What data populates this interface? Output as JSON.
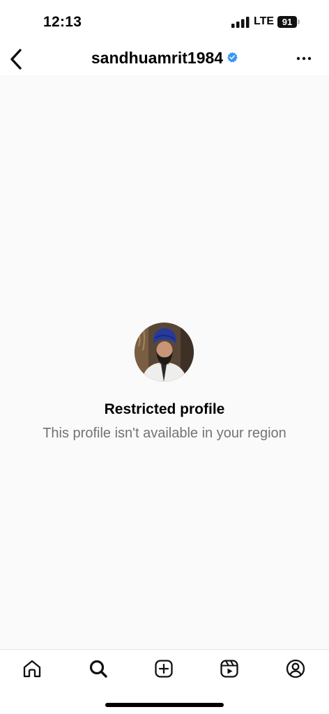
{
  "status_bar": {
    "time": "12:13",
    "network": "LTE",
    "battery_level": "91"
  },
  "header": {
    "username": "sandhuamrit1984",
    "verified": true,
    "accent_color": "#3897f0"
  },
  "restricted": {
    "title": "Restricted profile",
    "message": "This profile isn't available in your region"
  },
  "tab_bar": {
    "tabs": [
      {
        "icon": "home-icon"
      },
      {
        "icon": "search-icon",
        "active": true
      },
      {
        "icon": "create-post-icon"
      },
      {
        "icon": "reels-icon"
      },
      {
        "icon": "profile-icon"
      }
    ]
  },
  "colors": {
    "background": "#fafafa",
    "secondary_text": "#737373"
  }
}
